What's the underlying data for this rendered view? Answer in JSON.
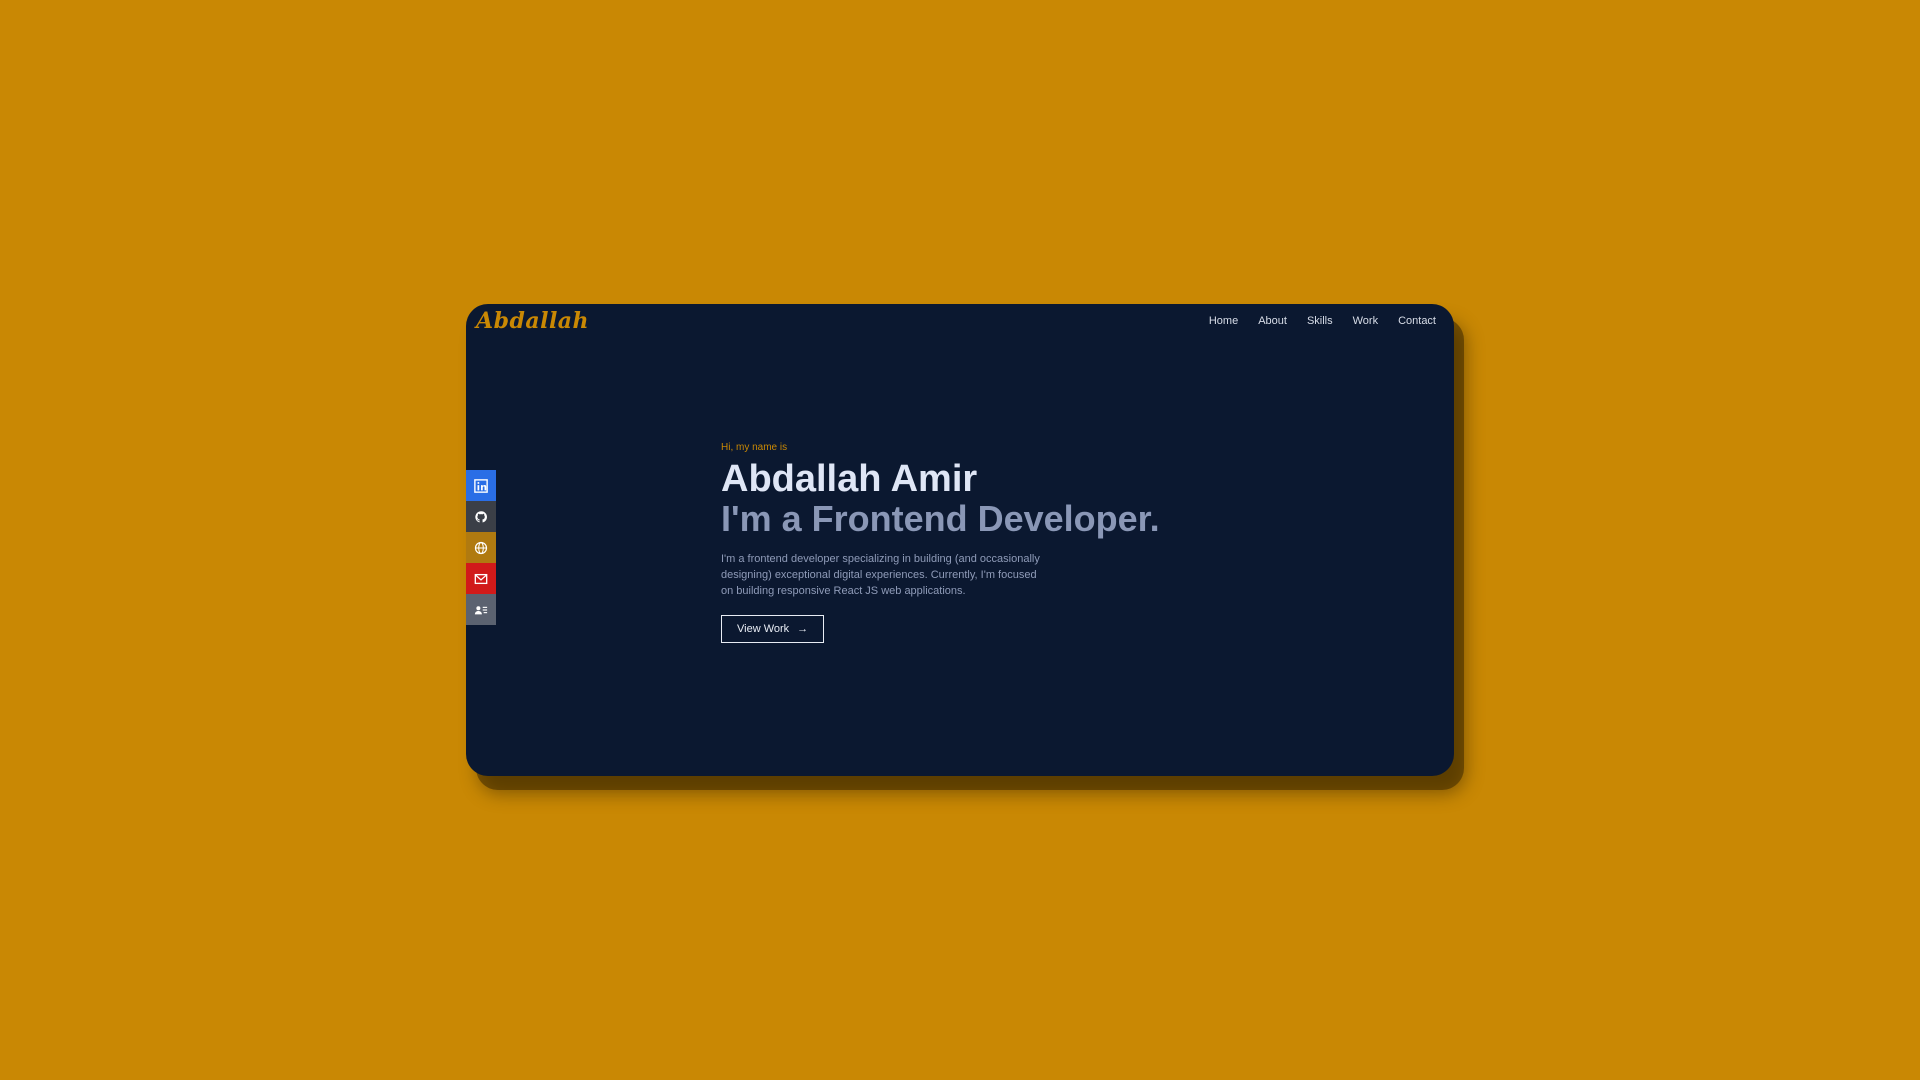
{
  "brand": {
    "logo_text": "Abdallah",
    "accent": "#c98804"
  },
  "nav": {
    "items": [
      {
        "label": "Home"
      },
      {
        "label": "About"
      },
      {
        "label": "Skills"
      },
      {
        "label": "Work"
      },
      {
        "label": "Contact"
      }
    ]
  },
  "socials": [
    {
      "icon": "linkedin-icon",
      "color": "#2a6ee6"
    },
    {
      "icon": "github-icon",
      "color": "#3b3f47"
    },
    {
      "icon": "globe-icon",
      "color": "#b07a10"
    },
    {
      "icon": "mail-icon",
      "color": "#d11a1a"
    },
    {
      "icon": "contact-card-icon",
      "color": "#5b6270"
    }
  ],
  "hero": {
    "greeting": "Hi, my name is",
    "name": "Abdallah Amir",
    "role": "I'm a Frontend Developer.",
    "description": "I'm a frontend developer specializing in building (and occasionally designing) exceptional digital experiences. Currently, I'm focused on building responsive React JS web applications.",
    "cta_label": "View Work",
    "cta_arrow": "→"
  },
  "colors": {
    "background": "#c98804",
    "panel": "#0b1830",
    "name": "#dfe6f6",
    "role": "#8a97b6"
  }
}
